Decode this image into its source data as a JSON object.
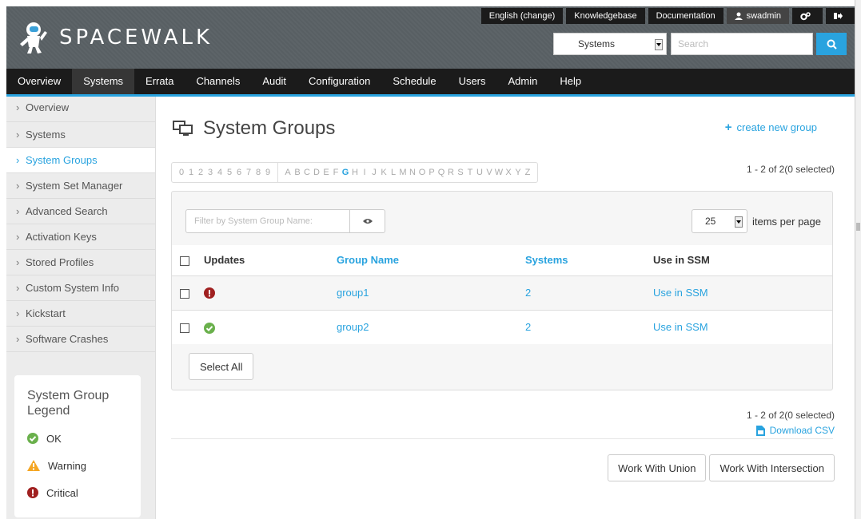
{
  "header": {
    "app_name": "SPACEWALK",
    "top_links": [
      "English (change)",
      "Knowledgebase",
      "Documentation"
    ],
    "user": "swadmin",
    "search_scope": "Systems",
    "search_placeholder": "Search"
  },
  "nav": {
    "items": [
      "Overview",
      "Systems",
      "Errata",
      "Channels",
      "Audit",
      "Configuration",
      "Schedule",
      "Users",
      "Admin",
      "Help"
    ],
    "active": "Systems"
  },
  "sidebar": {
    "items": [
      "Overview",
      "Systems",
      "System Groups",
      "System Set Manager",
      "Advanced Search",
      "Activation Keys",
      "Stored Profiles",
      "Custom System Info",
      "Kickstart",
      "Software Crashes"
    ],
    "active": "System Groups"
  },
  "legend": {
    "title": "System Group Legend",
    "items": [
      {
        "icon": "ok-icon",
        "label": "OK"
      },
      {
        "icon": "warning-icon",
        "label": "Warning"
      },
      {
        "icon": "critical-icon",
        "label": "Critical"
      }
    ]
  },
  "page": {
    "title": "System Groups",
    "create_link": "create new group",
    "alpha_digits": [
      "0",
      "1",
      "2",
      "3",
      "4",
      "5",
      "6",
      "7",
      "8",
      "9"
    ],
    "alpha_letters": [
      "A",
      "B",
      "C",
      "D",
      "E",
      "F",
      "G",
      "H",
      "I",
      "J",
      "K",
      "L",
      "M",
      "N",
      "O",
      "P",
      "Q",
      "R",
      "S",
      "T",
      "U",
      "V",
      "W",
      "X",
      "Y",
      "Z"
    ],
    "alpha_active": "G",
    "count_text": "1 - 2 of 2(0 selected)",
    "filter_placeholder": "Filter by System Group Name:",
    "per_page_value": "25",
    "per_page_label": "items per page",
    "columns": [
      "Updates",
      "Group Name",
      "Systems",
      "Use in SSM"
    ],
    "rows": [
      {
        "status": "critical-icon",
        "name": "group1",
        "systems": "2",
        "ssm": "Use in SSM"
      },
      {
        "status": "ok-icon",
        "name": "group2",
        "systems": "2",
        "ssm": "Use in SSM"
      }
    ],
    "select_all": "Select All",
    "download_csv": "Download CSV",
    "union_button": "Work With Union",
    "intersection_button": "Work With Intersection"
  },
  "colors": {
    "accent": "#29a3df",
    "ok": "#6ab04c",
    "warning": "#f5a623",
    "critical": "#a02020"
  }
}
